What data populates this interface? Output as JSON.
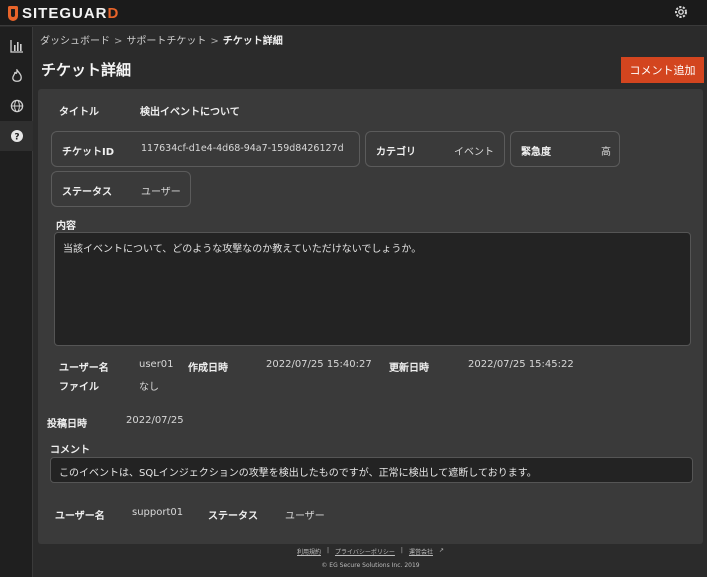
{
  "app": {
    "logo_prefix": "SITEGUAR",
    "logo_suffix": "D"
  },
  "icons": {
    "gear": "gear-icon",
    "sidebar": [
      "bar-chart-icon",
      "flame-icon",
      "globe-icon",
      "help-icon"
    ]
  },
  "colors": {
    "accent": "#d3451f",
    "background": "#2b2b2b",
    "panel": "#3a3a3a"
  },
  "breadcrumb": {
    "items": [
      "ダッシュボード",
      "サポートチケット",
      "チケット詳細"
    ],
    "separator": ">"
  },
  "page": {
    "title": "チケット詳細",
    "add_comment_label": "コメント追加"
  },
  "ticket": {
    "title_label": "タイトル",
    "title_value": "検出イベントについて",
    "id_label": "チケットID",
    "id_value": "117634cf-d1e4-4d68-94a7-159d8426127d",
    "category_label": "カテゴリ",
    "category_value": "イベント",
    "urgency_label": "緊急度",
    "urgency_value": "高",
    "status_label": "ステータス",
    "status_value": "ユーザー",
    "content_label": "内容",
    "content_value": "当該イベントについて、どのような攻撃なのか教えていただけないでしょうか。",
    "user_label": "ユーザー名",
    "user_value": "user01",
    "created_label": "作成日時",
    "created_value": "2022/07/25 15:40:27",
    "updated_label": "更新日時",
    "updated_value": "2022/07/25 15:45:22",
    "file_label": "ファイル",
    "file_value": "なし"
  },
  "comment": {
    "posted_label": "投稿日時",
    "posted_value": "2022/07/25",
    "comment_label": "コメント",
    "comment_value": "このイベントは、SQLインジェクションの攻撃を検出したものですが、正常に検出して遮断しております。",
    "user_label": "ユーザー名",
    "user_value": "support01",
    "status_label": "ステータス",
    "status_value": "ユーザー"
  },
  "footer": {
    "terms": "利用規約",
    "divider": "|",
    "privacy": "プライバシーポリシー",
    "company": "運営会社",
    "copyright": "© EG Secure Solutions Inc. 2019"
  }
}
